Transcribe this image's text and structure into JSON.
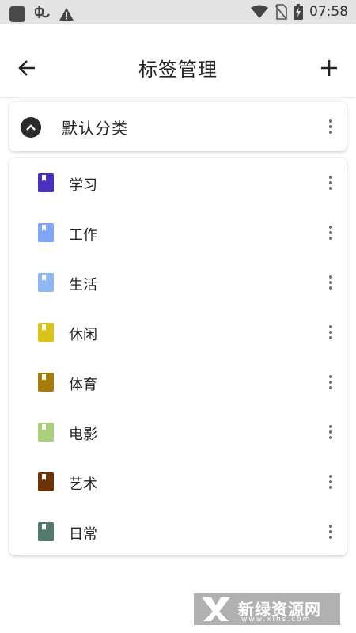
{
  "status_bar": {
    "time": "07:58",
    "icons": [
      "app-square-icon",
      "bug-icon",
      "warning-icon",
      "wifi-icon",
      "no-sim-icon",
      "battery-charging-icon"
    ]
  },
  "app_bar": {
    "title": "标签管理",
    "back_icon": "arrow-left-icon",
    "add_icon": "plus-icon"
  },
  "category": {
    "name": "默认分类",
    "expanded": true,
    "toggle_icon": "chevron-up-icon",
    "more_icon": "more-vertical-icon"
  },
  "tags": [
    {
      "label": "学习",
      "color": "#4b2fbf"
    },
    {
      "label": "工作",
      "color": "#7ea6f5"
    },
    {
      "label": "生活",
      "color": "#8fb7f2"
    },
    {
      "label": "休闲",
      "color": "#d9c21a"
    },
    {
      "label": "体育",
      "color": "#a57c0c"
    },
    {
      "label": "电影",
      "color": "#a9cf7a"
    },
    {
      "label": "艺术",
      "color": "#6b3306"
    },
    {
      "label": "日常",
      "color": "#53796a"
    }
  ],
  "watermark": {
    "brand": "新绿资源网",
    "url": "www.xlhs.com"
  }
}
